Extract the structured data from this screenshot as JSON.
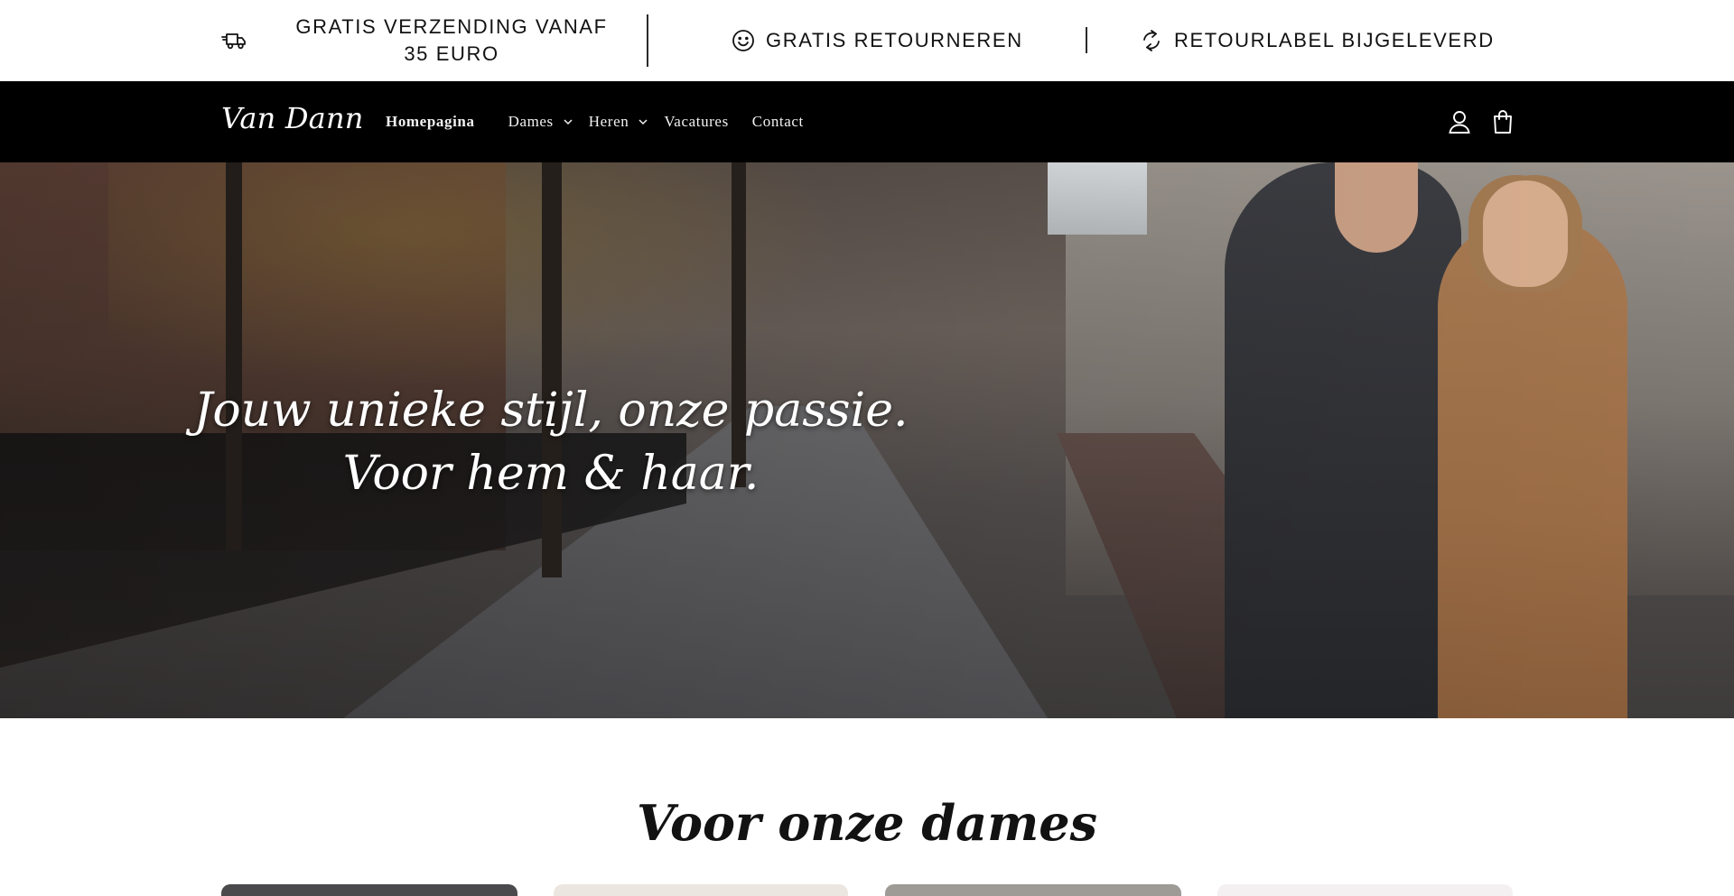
{
  "announcement": {
    "items": [
      {
        "icon": "delivery-truck-icon",
        "text": "GRATIS VERZENDING VANAF 35 EURO"
      },
      {
        "icon": "smiley-icon",
        "text": "GRATIS RETOURNEREN"
      },
      {
        "icon": "refresh-icon",
        "text": "RETOURLABEL BIJGELEVERD"
      }
    ]
  },
  "header": {
    "logo": "Van Dann",
    "nav": [
      {
        "label": "Homepagina",
        "active": true
      },
      {
        "label": "Dames",
        "dropdown": true
      },
      {
        "label": "Heren",
        "dropdown": true
      },
      {
        "label": "Vacatures"
      },
      {
        "label": "Contact"
      }
    ],
    "icons": [
      "account-icon",
      "cart-icon"
    ]
  },
  "hero": {
    "line1": "Jouw unieke stijl, onze passie.",
    "line2": "Voor hem & haar."
  },
  "section": {
    "title": "Voor onze dames"
  },
  "colors": {
    "header_bg": "#000000",
    "announcement_bg": "#ffffff",
    "text": "#121212"
  }
}
